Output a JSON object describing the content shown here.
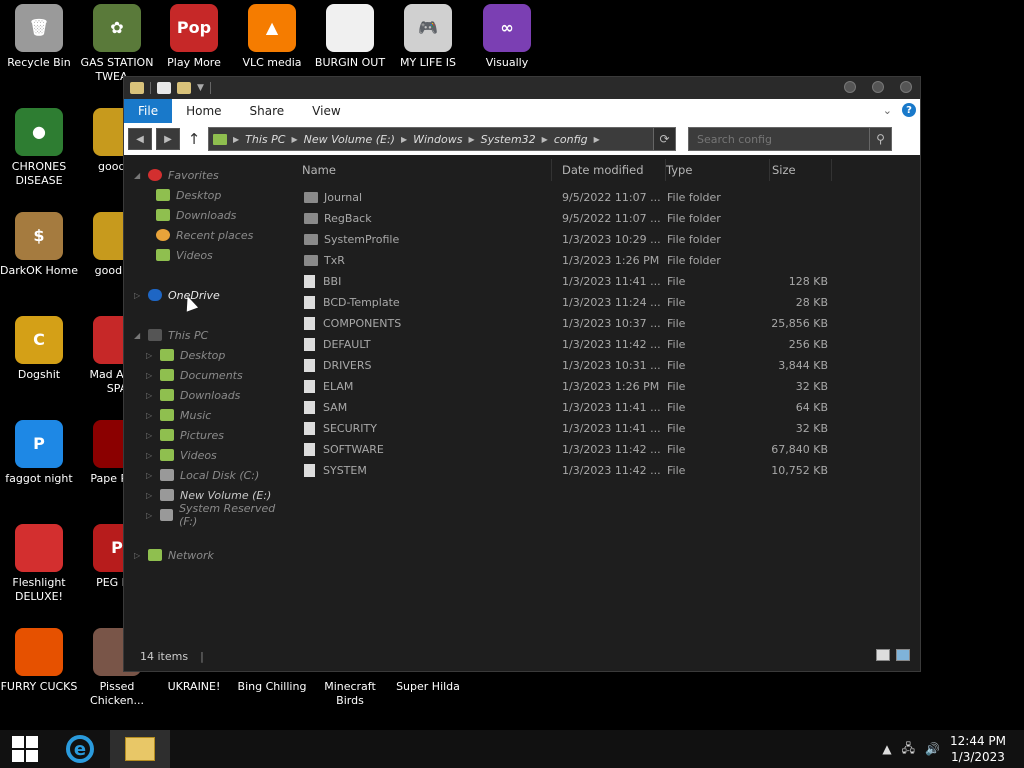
{
  "desktop_icons": [
    {
      "label": "Recycle Bin",
      "icon": "recycle-bin-icon",
      "color": "#9a9a9a",
      "glyph": "🗑"
    },
    {
      "label": "GAS STATION TWEA…",
      "icon": "flower-icon",
      "color": "#5a7a3a",
      "glyph": "✿"
    },
    {
      "label": "Play More",
      "icon": "popcap-icon",
      "color": "#c62828",
      "glyph": "Pop"
    },
    {
      "label": "VLC media",
      "icon": "vlc-cone-icon",
      "color": "#f57c00",
      "glyph": "▲"
    },
    {
      "label": "BURGIN OUT",
      "icon": "blank-file-icon",
      "color": "#f0f0f0",
      "glyph": ""
    },
    {
      "label": "MY LIFE IS",
      "icon": "gamepad-icon",
      "color": "#d0d0d0",
      "glyph": "🎮"
    },
    {
      "label": "Visually",
      "icon": "visual-studio-icon",
      "color": "#7b3fb3",
      "glyph": "∞"
    },
    {
      "label": "CHRONES DISEASE",
      "icon": "chrome-icon",
      "color": "#2e7d32",
      "glyph": "●"
    },
    {
      "label": "good g",
      "icon": "game-box-icon",
      "color": "#c79a1d",
      "glyph": ""
    },
    {
      "label": "DarkOK Home",
      "icon": "money-bag-icon",
      "color": "#a57b3f",
      "glyph": "$"
    },
    {
      "label": "good ga",
      "icon": "game-box-icon",
      "color": "#c79a1d",
      "glyph": ""
    },
    {
      "label": "Dogshit",
      "icon": "codeblocks-icon",
      "color": "#d4a017",
      "glyph": "C"
    },
    {
      "label": "Mad Av IN SPA",
      "icon": "angry-birds-icon",
      "color": "#c62828",
      "glyph": ""
    },
    {
      "label": "faggot night",
      "icon": "p-logo-icon",
      "color": "#1e88e5",
      "glyph": "P"
    },
    {
      "label": "Pape Plea",
      "icon": "papers-please-icon",
      "color": "#8b0000",
      "glyph": ""
    },
    {
      "label": "Fleshlight DELUXE!",
      "icon": "red-fuzzball-icon",
      "color": "#d32f2f",
      "glyph": ""
    },
    {
      "label": "PEG MY",
      "icon": "peggle-icon",
      "color": "#b71c1c",
      "glyph": "P"
    },
    {
      "label": "FURRY CUCKS",
      "icon": "firefox-icon",
      "color": "#e65100",
      "glyph": ""
    },
    {
      "label": "Pissed Chicken...",
      "icon": "chicken-game-icon",
      "color": "#795548",
      "glyph": ""
    },
    {
      "label": "UKRAINE!",
      "icon": "app-icon",
      "color": "#000000",
      "glyph": ""
    },
    {
      "label": "Bing Chilling",
      "icon": "app-icon",
      "color": "#000000",
      "glyph": ""
    },
    {
      "label": "Minecraft Birds",
      "icon": "app-icon",
      "color": "#000000",
      "glyph": ""
    },
    {
      "label": "Super Hilda",
      "icon": "app-icon",
      "color": "#000000",
      "glyph": ""
    }
  ],
  "ribbon": {
    "tabs": [
      "File",
      "Home",
      "Share",
      "View"
    ]
  },
  "address": {
    "crumbs": [
      "This PC",
      "New Volume (E:)",
      "Windows",
      "System32",
      "config"
    ]
  },
  "search": {
    "placeholder": "Search config"
  },
  "navpane": {
    "favorites": {
      "label": "Favorites",
      "items": [
        "Desktop",
        "Downloads",
        "Recent places",
        "Videos"
      ]
    },
    "onedrive": "OneDrive",
    "thispc": {
      "label": "This PC",
      "items": [
        "Desktop",
        "Documents",
        "Downloads",
        "Music",
        "Pictures",
        "Videos",
        "Local Disk (C:)",
        "New Volume (E:)",
        "System Reserved (F:)"
      ]
    },
    "network": "Network"
  },
  "columns": {
    "name": "Name",
    "date": "Date modified",
    "type": "Type",
    "size": "Size"
  },
  "files": [
    {
      "name": "Journal",
      "date": "9/5/2022 11:07 ...",
      "type": "File folder",
      "size": "",
      "kind": "folder"
    },
    {
      "name": "RegBack",
      "date": "9/5/2022 11:07 ...",
      "type": "File folder",
      "size": "",
      "kind": "folder"
    },
    {
      "name": "SystemProfile",
      "date": "1/3/2023 10:29 ...",
      "type": "File folder",
      "size": "",
      "kind": "folder"
    },
    {
      "name": "TxR",
      "date": "1/3/2023 1:26 PM",
      "type": "File folder",
      "size": "",
      "kind": "folder"
    },
    {
      "name": "BBI",
      "date": "1/3/2023 11:41 ...",
      "type": "File",
      "size": "128 KB",
      "kind": "file"
    },
    {
      "name": "BCD-Template",
      "date": "1/3/2023 11:24 ...",
      "type": "File",
      "size": "28 KB",
      "kind": "file"
    },
    {
      "name": "COMPONENTS",
      "date": "1/3/2023 10:37 ...",
      "type": "File",
      "size": "25,856 KB",
      "kind": "file"
    },
    {
      "name": "DEFAULT",
      "date": "1/3/2023 11:42 ...",
      "type": "File",
      "size": "256 KB",
      "kind": "file"
    },
    {
      "name": "DRIVERS",
      "date": "1/3/2023 10:31 ...",
      "type": "File",
      "size": "3,844 KB",
      "kind": "file"
    },
    {
      "name": "ELAM",
      "date": "1/3/2023 1:26 PM",
      "type": "File",
      "size": "32 KB",
      "kind": "file"
    },
    {
      "name": "SAM",
      "date": "1/3/2023 11:41 ...",
      "type": "File",
      "size": "64 KB",
      "kind": "file"
    },
    {
      "name": "SECURITY",
      "date": "1/3/2023 11:41 ...",
      "type": "File",
      "size": "32 KB",
      "kind": "file"
    },
    {
      "name": "SOFTWARE",
      "date": "1/3/2023 11:42 ...",
      "type": "File",
      "size": "67,840 KB",
      "kind": "file"
    },
    {
      "name": "SYSTEM",
      "date": "1/3/2023 11:42 ...",
      "type": "File",
      "size": "10,752 KB",
      "kind": "file"
    }
  ],
  "status": {
    "count": "14 items"
  },
  "taskbar": {
    "time": "12:44 PM",
    "date": "1/3/2023"
  },
  "colors": {
    "accent": "#1979ca",
    "folder": "#8a8a8a",
    "window_bg": "#1e1e1e"
  }
}
